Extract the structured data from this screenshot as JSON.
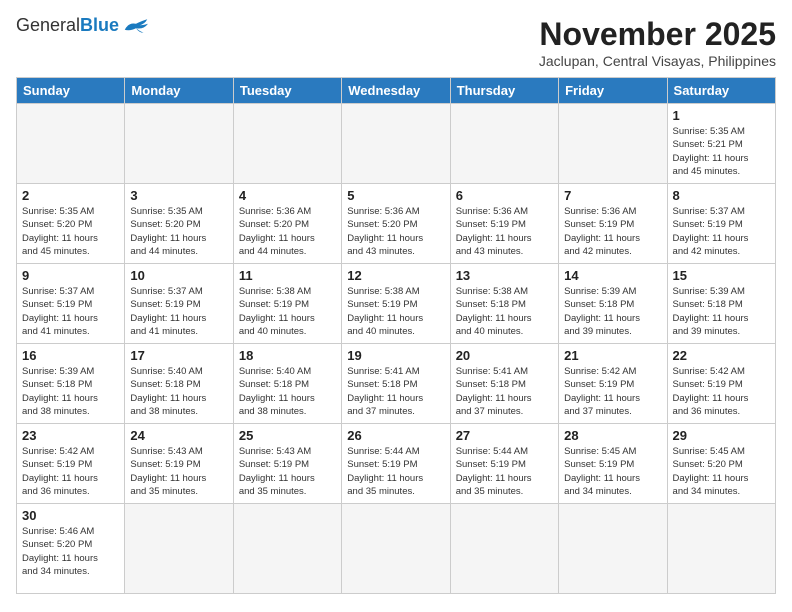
{
  "header": {
    "logo_general": "General",
    "logo_blue": "Blue",
    "month": "November 2025",
    "location": "Jaclupan, Central Visayas, Philippines"
  },
  "days_of_week": [
    "Sunday",
    "Monday",
    "Tuesday",
    "Wednesday",
    "Thursday",
    "Friday",
    "Saturday"
  ],
  "weeks": [
    [
      {
        "day": "",
        "info": ""
      },
      {
        "day": "",
        "info": ""
      },
      {
        "day": "",
        "info": ""
      },
      {
        "day": "",
        "info": ""
      },
      {
        "day": "",
        "info": ""
      },
      {
        "day": "",
        "info": ""
      },
      {
        "day": "1",
        "info": "Sunrise: 5:35 AM\nSunset: 5:21 PM\nDaylight: 11 hours\nand 45 minutes."
      }
    ],
    [
      {
        "day": "2",
        "info": "Sunrise: 5:35 AM\nSunset: 5:20 PM\nDaylight: 11 hours\nand 45 minutes."
      },
      {
        "day": "3",
        "info": "Sunrise: 5:35 AM\nSunset: 5:20 PM\nDaylight: 11 hours\nand 44 minutes."
      },
      {
        "day": "4",
        "info": "Sunrise: 5:36 AM\nSunset: 5:20 PM\nDaylight: 11 hours\nand 44 minutes."
      },
      {
        "day": "5",
        "info": "Sunrise: 5:36 AM\nSunset: 5:20 PM\nDaylight: 11 hours\nand 43 minutes."
      },
      {
        "day": "6",
        "info": "Sunrise: 5:36 AM\nSunset: 5:19 PM\nDaylight: 11 hours\nand 43 minutes."
      },
      {
        "day": "7",
        "info": "Sunrise: 5:36 AM\nSunset: 5:19 PM\nDaylight: 11 hours\nand 42 minutes."
      },
      {
        "day": "8",
        "info": "Sunrise: 5:37 AM\nSunset: 5:19 PM\nDaylight: 11 hours\nand 42 minutes."
      }
    ],
    [
      {
        "day": "9",
        "info": "Sunrise: 5:37 AM\nSunset: 5:19 PM\nDaylight: 11 hours\nand 41 minutes."
      },
      {
        "day": "10",
        "info": "Sunrise: 5:37 AM\nSunset: 5:19 PM\nDaylight: 11 hours\nand 41 minutes."
      },
      {
        "day": "11",
        "info": "Sunrise: 5:38 AM\nSunset: 5:19 PM\nDaylight: 11 hours\nand 40 minutes."
      },
      {
        "day": "12",
        "info": "Sunrise: 5:38 AM\nSunset: 5:19 PM\nDaylight: 11 hours\nand 40 minutes."
      },
      {
        "day": "13",
        "info": "Sunrise: 5:38 AM\nSunset: 5:18 PM\nDaylight: 11 hours\nand 40 minutes."
      },
      {
        "day": "14",
        "info": "Sunrise: 5:39 AM\nSunset: 5:18 PM\nDaylight: 11 hours\nand 39 minutes."
      },
      {
        "day": "15",
        "info": "Sunrise: 5:39 AM\nSunset: 5:18 PM\nDaylight: 11 hours\nand 39 minutes."
      }
    ],
    [
      {
        "day": "16",
        "info": "Sunrise: 5:39 AM\nSunset: 5:18 PM\nDaylight: 11 hours\nand 38 minutes."
      },
      {
        "day": "17",
        "info": "Sunrise: 5:40 AM\nSunset: 5:18 PM\nDaylight: 11 hours\nand 38 minutes."
      },
      {
        "day": "18",
        "info": "Sunrise: 5:40 AM\nSunset: 5:18 PM\nDaylight: 11 hours\nand 38 minutes."
      },
      {
        "day": "19",
        "info": "Sunrise: 5:41 AM\nSunset: 5:18 PM\nDaylight: 11 hours\nand 37 minutes."
      },
      {
        "day": "20",
        "info": "Sunrise: 5:41 AM\nSunset: 5:18 PM\nDaylight: 11 hours\nand 37 minutes."
      },
      {
        "day": "21",
        "info": "Sunrise: 5:42 AM\nSunset: 5:19 PM\nDaylight: 11 hours\nand 37 minutes."
      },
      {
        "day": "22",
        "info": "Sunrise: 5:42 AM\nSunset: 5:19 PM\nDaylight: 11 hours\nand 36 minutes."
      }
    ],
    [
      {
        "day": "23",
        "info": "Sunrise: 5:42 AM\nSunset: 5:19 PM\nDaylight: 11 hours\nand 36 minutes."
      },
      {
        "day": "24",
        "info": "Sunrise: 5:43 AM\nSunset: 5:19 PM\nDaylight: 11 hours\nand 35 minutes."
      },
      {
        "day": "25",
        "info": "Sunrise: 5:43 AM\nSunset: 5:19 PM\nDaylight: 11 hours\nand 35 minutes."
      },
      {
        "day": "26",
        "info": "Sunrise: 5:44 AM\nSunset: 5:19 PM\nDaylight: 11 hours\nand 35 minutes."
      },
      {
        "day": "27",
        "info": "Sunrise: 5:44 AM\nSunset: 5:19 PM\nDaylight: 11 hours\nand 35 minutes."
      },
      {
        "day": "28",
        "info": "Sunrise: 5:45 AM\nSunset: 5:19 PM\nDaylight: 11 hours\nand 34 minutes."
      },
      {
        "day": "29",
        "info": "Sunrise: 5:45 AM\nSunset: 5:20 PM\nDaylight: 11 hours\nand 34 minutes."
      }
    ],
    [
      {
        "day": "30",
        "info": "Sunrise: 5:46 AM\nSunset: 5:20 PM\nDaylight: 11 hours\nand 34 minutes."
      },
      {
        "day": "",
        "info": ""
      },
      {
        "day": "",
        "info": ""
      },
      {
        "day": "",
        "info": ""
      },
      {
        "day": "",
        "info": ""
      },
      {
        "day": "",
        "info": ""
      },
      {
        "day": "",
        "info": ""
      }
    ]
  ]
}
